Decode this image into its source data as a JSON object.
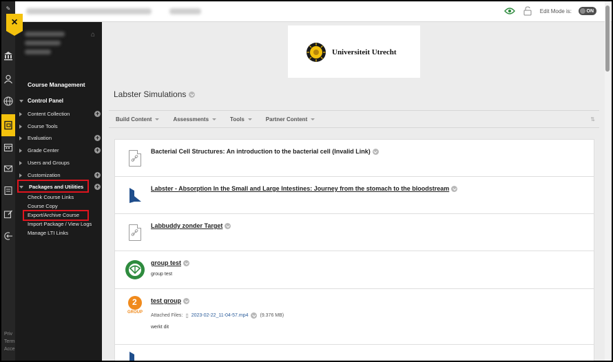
{
  "topbar": {
    "edit_mode_label": "Edit Mode is:",
    "edit_mode_state": "ON"
  },
  "rail": {
    "close_label": "×",
    "footer_lines": [
      "Priv",
      "Term",
      "Acce"
    ]
  },
  "course_menu": {
    "section_title": "Course Management",
    "control_panel": "Control Panel",
    "items": [
      {
        "label": "Content Collection",
        "plus": true
      },
      {
        "label": "Course Tools",
        "plus": false
      },
      {
        "label": "Evaluation",
        "plus": true
      },
      {
        "label": "Grade Center",
        "plus": true
      },
      {
        "label": "Users and Groups",
        "plus": false
      },
      {
        "label": "Customization",
        "plus": true
      },
      {
        "label": "Packages and Utilities",
        "plus": true
      }
    ],
    "sub_items": [
      "Check Course Links",
      "Course Copy",
      "Export/Archive Course",
      "Import Package / View Logs",
      "Manage LTI Links"
    ]
  },
  "banner": {
    "institution": "Universiteit Utrecht"
  },
  "page": {
    "title": "Labster Simulations"
  },
  "actionbar": {
    "items": [
      "Build Content",
      "Assessments",
      "Tools",
      "Partner Content"
    ]
  },
  "content_items": [
    {
      "title": "Bacterial Cell Structures: An introduction to the bacterial cell (Invalid Link)",
      "icon": "link-icon"
    },
    {
      "title": "Labster - Absorption In the Small and Large Intestines: Journey from the stomach to the bloodstream",
      "icon": "labster-icon"
    },
    {
      "title": "Labbuddy zonder Target",
      "icon": "link-icon"
    },
    {
      "title": "group test",
      "icon": "group-icon",
      "description": "group test"
    },
    {
      "title": "test group",
      "icon": "group-number-icon",
      "icon_number": "2",
      "icon_label": "GROUP",
      "attached_label": "Attached Files:",
      "attachment_name": "2023-02-22_11-04-57.mp4",
      "attachment_size": "(9.376 MB)",
      "description": "werkt dit"
    }
  ],
  "colors": {
    "accent_yellow": "#f4c20d",
    "highlight_red": "#e0141e",
    "menu_bg": "#1b1b1b",
    "labster_blue": "#1f4e8c",
    "group_green": "#2e8b3e",
    "group_orange": "#f08a1c"
  }
}
